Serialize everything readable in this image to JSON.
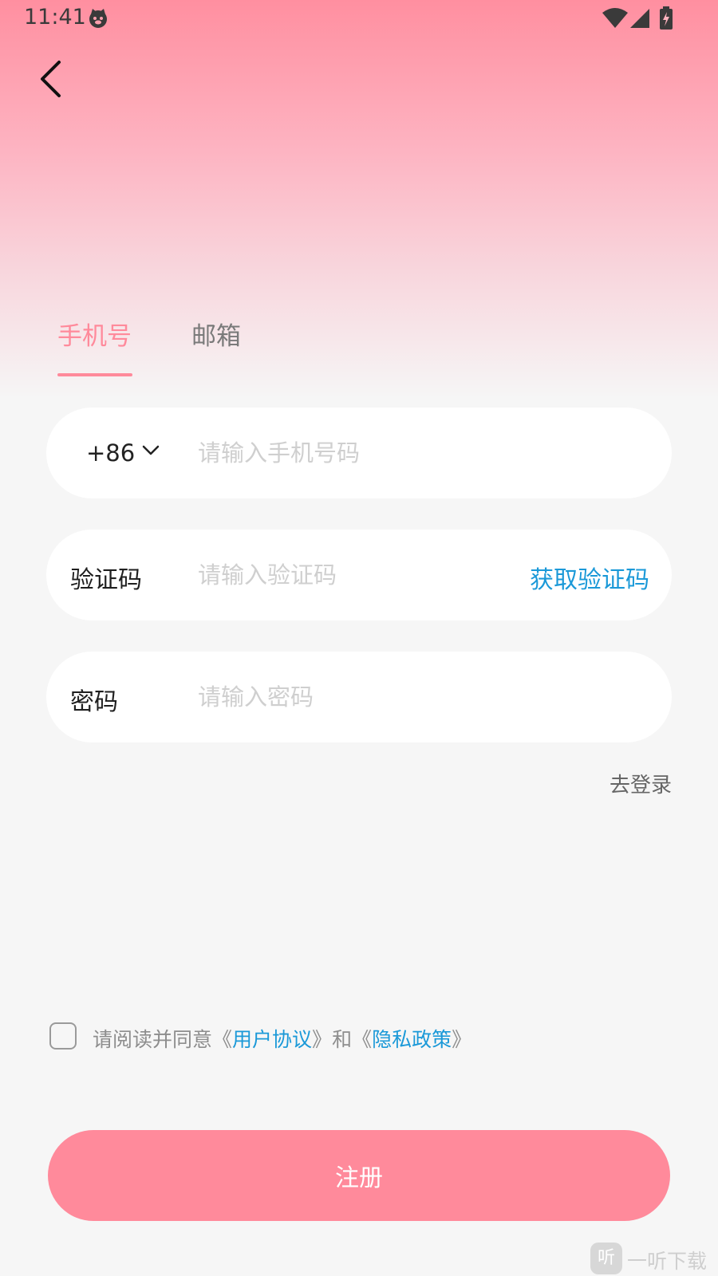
{
  "status_bar": {
    "time": "11:41",
    "app_icon": "cat-face-icon",
    "wifi_icon": "wifi-icon",
    "signal_icon": "cellular-signal-icon",
    "battery_icon": "battery-charging-icon"
  },
  "header": {
    "back_icon": "chevron-left-icon"
  },
  "tabs": [
    {
      "label": "手机号",
      "active": true
    },
    {
      "label": "邮箱",
      "active": false
    }
  ],
  "form": {
    "phone": {
      "country_code": "+86",
      "placeholder": "请输入手机号码",
      "value": ""
    },
    "code": {
      "label": "验证码",
      "placeholder": "请输入验证码",
      "value": "",
      "action": "获取验证码"
    },
    "password": {
      "label": "密码",
      "placeholder": "请输入密码",
      "value": ""
    }
  },
  "go_login": "去登录",
  "agreement": {
    "checked": false,
    "prefix": "请阅读并同意",
    "open_bracket_1": "《",
    "terms": "用户协议",
    "close_bracket_1": "》",
    "and": "和",
    "open_bracket_2": "《",
    "privacy": "隐私政策",
    "close_bracket_2": "》"
  },
  "register_button": "注册",
  "watermark": {
    "logo_char": "听",
    "text": "一听下载"
  },
  "colors": {
    "accent": "#ff8a9b",
    "link": "#1b99d8",
    "background": "#f6f6f6"
  }
}
